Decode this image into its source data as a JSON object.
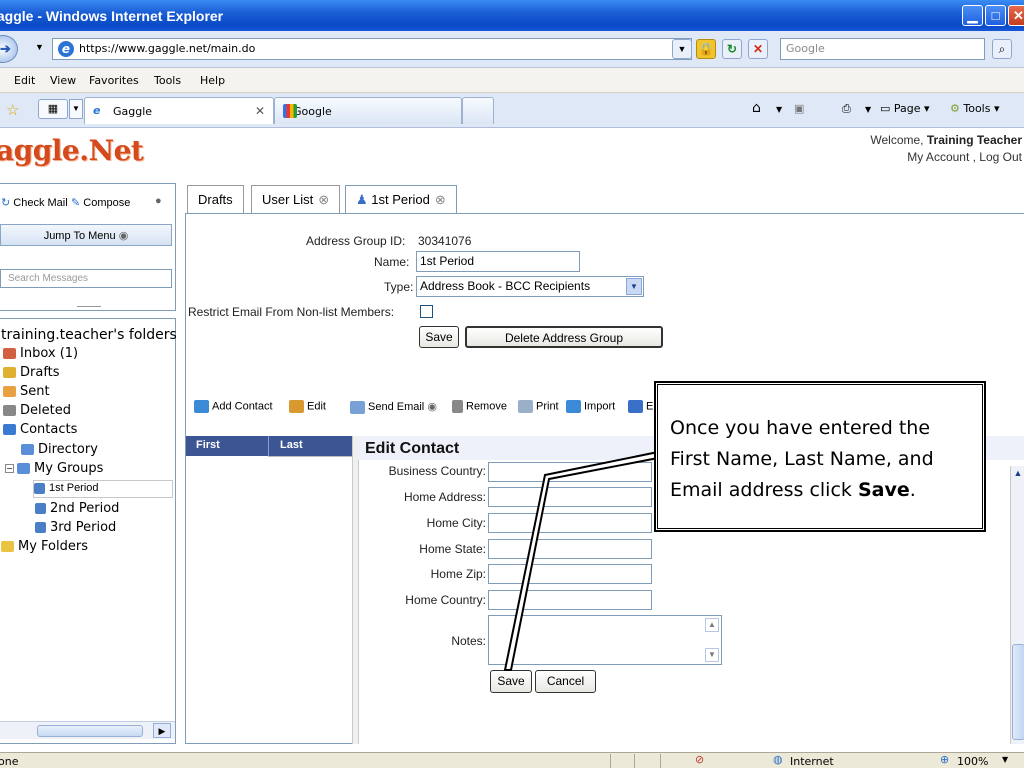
{
  "window": {
    "title": "Gaggle - Windows Internet Explorer"
  },
  "address_bar": {
    "url": "https://www.gaggle.net/main.do",
    "search_placeholder": "Google"
  },
  "menu": [
    "Edit",
    "View",
    "Favorites",
    "Tools",
    "Help"
  ],
  "browser_tabs": [
    {
      "label": "Gaggle",
      "active": true
    },
    {
      "label": "Google",
      "active": false
    }
  ],
  "browser_commands": {
    "page": "Page",
    "tools": "Tools"
  },
  "site": {
    "logo": "aggle.Net",
    "welcome_prefix": "Welcome, ",
    "welcome_user": "Training Teacher",
    "account_links": "My Account , Log Out"
  },
  "left": {
    "check_mail": "Check Mail",
    "compose": "Compose",
    "jump_menu": "Jump To Menu",
    "search_placeholder": "Search Messages",
    "folders_title": "training.teacher's folders",
    "folders": [
      {
        "label": "Inbox (1)"
      },
      {
        "label": "Drafts"
      },
      {
        "label": "Sent"
      },
      {
        "label": "Deleted"
      },
      {
        "label": "Contacts"
      },
      {
        "label": "Directory"
      },
      {
        "label": "My Groups"
      },
      {
        "label": "1st Period"
      },
      {
        "label": "2nd Period"
      },
      {
        "label": "3rd Period"
      },
      {
        "label": "My Folders"
      }
    ]
  },
  "page_tabs": [
    {
      "label": "Drafts"
    },
    {
      "label": "User List"
    },
    {
      "label": "1st Period"
    }
  ],
  "group_form": {
    "id_label": "Address Group ID:",
    "id_value": "30341076",
    "name_label": "Name:",
    "name_value": "1st Period",
    "type_label": "Type:",
    "type_value": "Address Book - BCC Recipients",
    "restrict_label": "Restrict Email From Non-list Members:",
    "save": "Save",
    "delete": "Delete Address Group"
  },
  "toolbar": {
    "add_contact": "Add Contact",
    "edit": "Edit",
    "send_email": "Send Email",
    "remove": "Remove",
    "print": "Print",
    "import": "Import",
    "next_truncated": "E"
  },
  "contact_list": {
    "col_first": "First",
    "col_last": "Last"
  },
  "edit_contact": {
    "title": "Edit Contact",
    "fields": [
      {
        "label": "Business Country:"
      },
      {
        "label": "Home Address:"
      },
      {
        "label": "Home City:"
      },
      {
        "label": "Home State:"
      },
      {
        "label": "Home Zip:"
      },
      {
        "label": "Home Country:"
      },
      {
        "label": "Notes:"
      }
    ],
    "save": "Save",
    "cancel": "Cancel"
  },
  "callout": {
    "text_before": "Once you have entered the First Name, Last Name, and Email address click ",
    "text_bold": "Save",
    "text_after": "."
  },
  "status_bar": {
    "left": "one",
    "zone": "Internet",
    "zoom": "100%"
  }
}
